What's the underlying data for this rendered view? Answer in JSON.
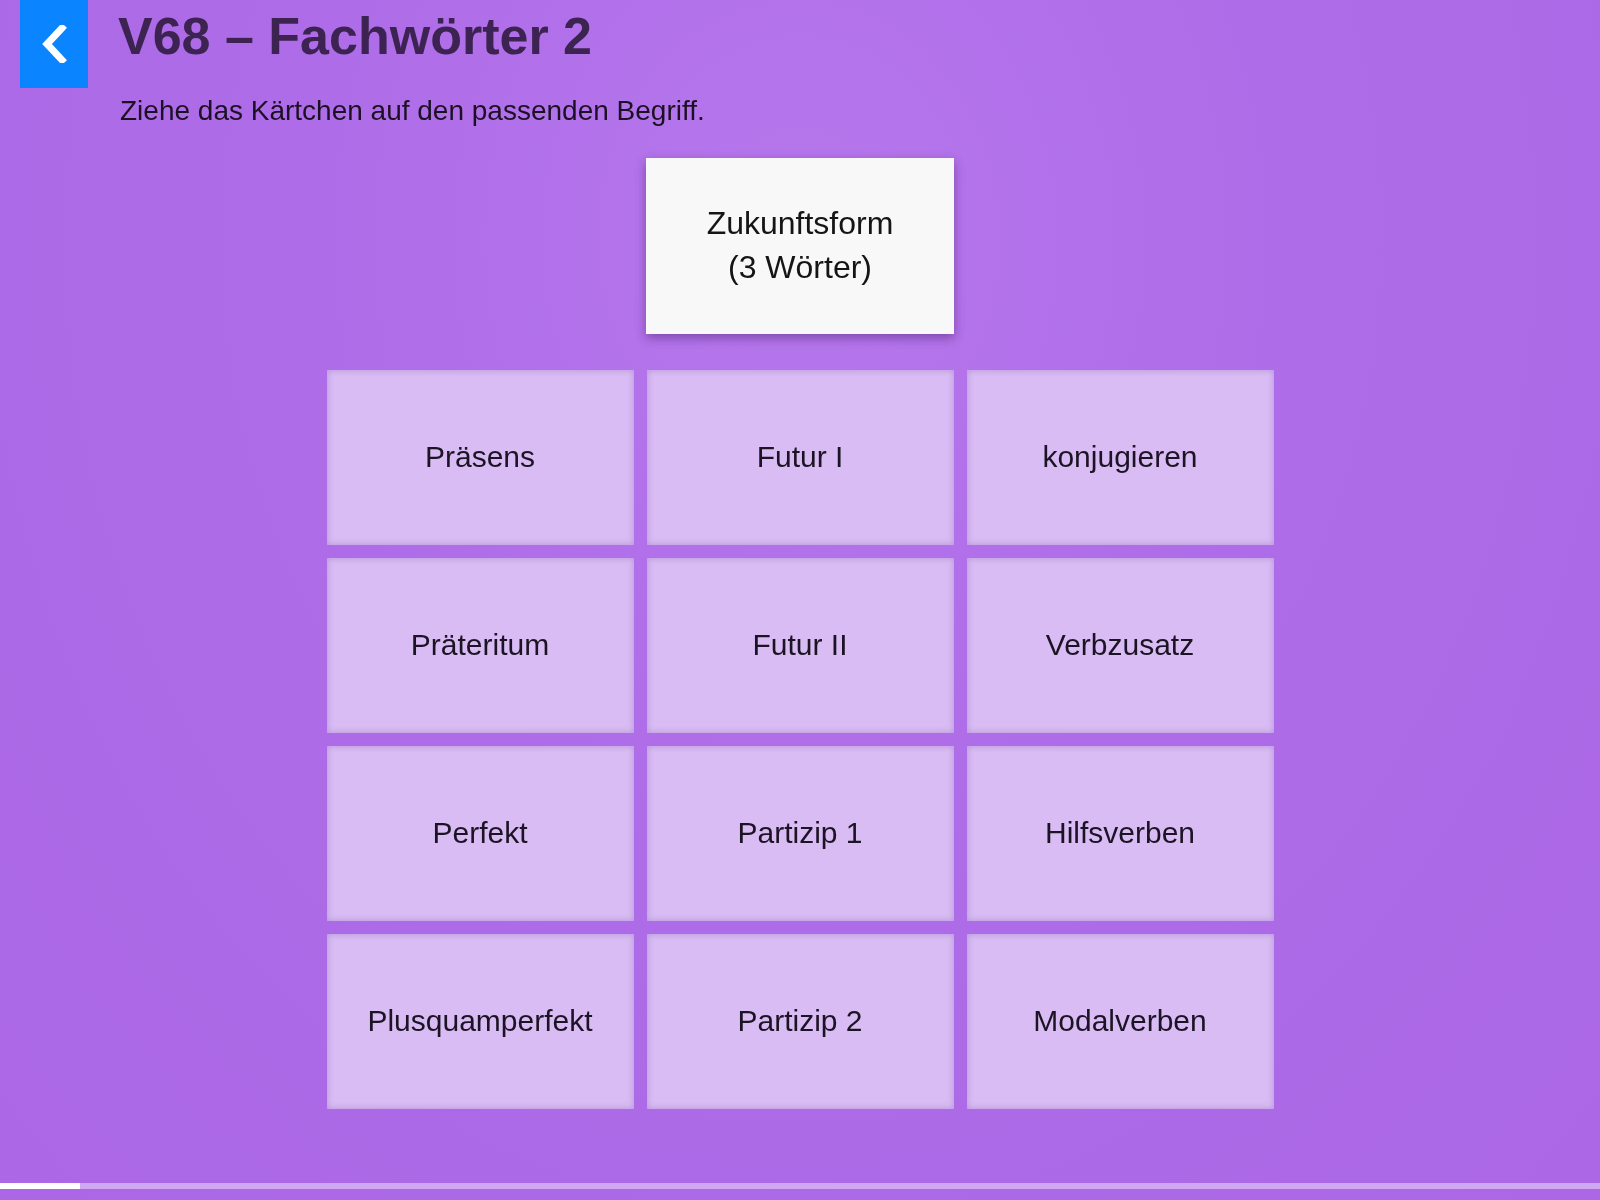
{
  "header": {
    "title": "V68 – Fachwörter 2",
    "instruction": "Ziehe das Kärtchen auf den passenden Begriff."
  },
  "drag_card": {
    "text": "Zukunftsform (3 Wörter)"
  },
  "targets": [
    {
      "label": "Präsens"
    },
    {
      "label": "Futur I"
    },
    {
      "label": "konjugieren"
    },
    {
      "label": "Präteritum"
    },
    {
      "label": "Futur II"
    },
    {
      "label": "Verbzusatz"
    },
    {
      "label": "Perfekt"
    },
    {
      "label": "Partizip 1"
    },
    {
      "label": "Hilfsverben"
    },
    {
      "label": "Plusquamperfekt"
    },
    {
      "label": "Partizip 2"
    },
    {
      "label": "Modalverben"
    }
  ],
  "progress": {
    "level": 0.05
  }
}
